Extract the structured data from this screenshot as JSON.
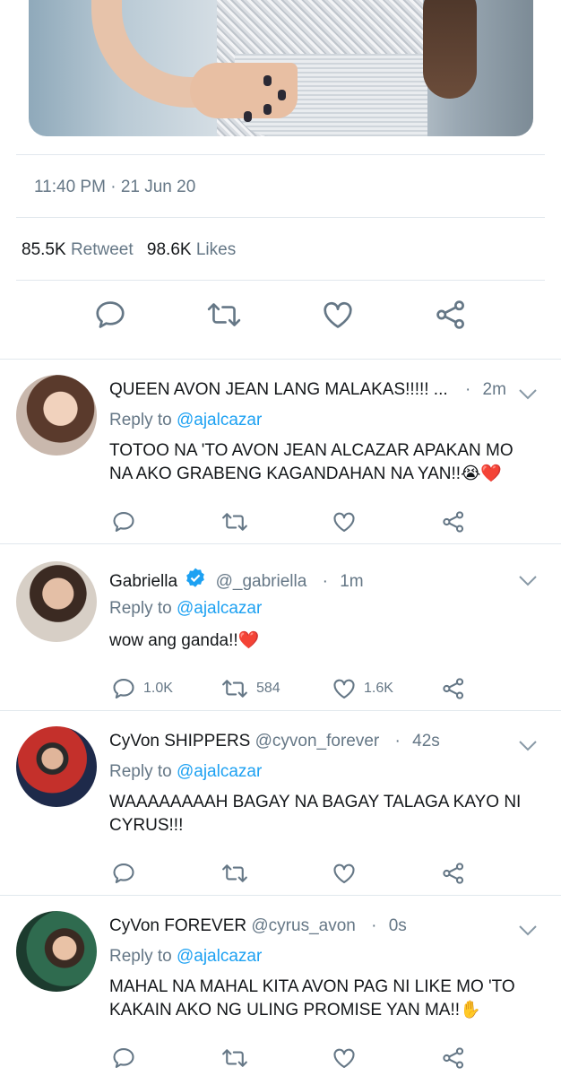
{
  "tweet_meta": {
    "time": "11:40 PM",
    "separator": "·",
    "date": "21 Jun 20"
  },
  "stats": {
    "retweets": "85.5K",
    "retweet_label": "Retweet",
    "likes": "98.6K",
    "likes_label": "Likes"
  },
  "icons": {
    "reply": "reply-icon",
    "retweet": "retweet-icon",
    "like": "heart-icon",
    "share": "share-icon",
    "more": "chevron-down-icon",
    "verified": "verified-badge-icon"
  },
  "colors": {
    "link": "#1da1f2",
    "muted": "#657786",
    "text": "#14171a",
    "divider": "#e1e8ed",
    "heart": "#e0245e"
  },
  "replies": [
    {
      "name": "QUEEN AVON JEAN LANG MALAKAS!!!!! ...",
      "handle": "",
      "dot": "·",
      "time": "2m",
      "reply_prefix": "Reply to",
      "reply_to": "@ajalcazar",
      "text": "TOTOO NA 'TO AVON JEAN ALCAZAR APAKAN MO NA AKO GRABENG KAGANDAHAN NA YAN!!😭❤️",
      "counts": {
        "replies": "",
        "retweets": "",
        "likes": ""
      }
    },
    {
      "name": "Gabriella",
      "handle": "@_gabriella",
      "dot": "·",
      "time": "1m",
      "reply_prefix": "Reply to",
      "reply_to": "@ajalcazar",
      "text": "wow ang ganda!!❤️",
      "counts": {
        "replies": "1.0K",
        "retweets": "584",
        "likes": "1.6K"
      }
    },
    {
      "name": "CyVon SHIPPERS",
      "handle": "@cyvon_forever",
      "dot": "·",
      "time": "42s",
      "reply_prefix": "Reply to",
      "reply_to": "@ajalcazar",
      "text": "WAAAAAAAAH BAGAY NA BAGAY TALAGA KAYO NI CYRUS!!!",
      "counts": {
        "replies": "",
        "retweets": "",
        "likes": ""
      }
    },
    {
      "name": "CyVon FOREVER",
      "handle": "@cyrus_avon",
      "dot": "·",
      "time": "0s",
      "reply_prefix": "Reply to",
      "reply_to": "@ajalcazar",
      "text": "MAHAL NA MAHAL KITA AVON PAG NI LIKE MO 'TO KAKAIN AKO NG ULING PROMISE YAN MA!!✋",
      "counts": {
        "replies": "",
        "retweets": "",
        "likes": ""
      }
    }
  ]
}
